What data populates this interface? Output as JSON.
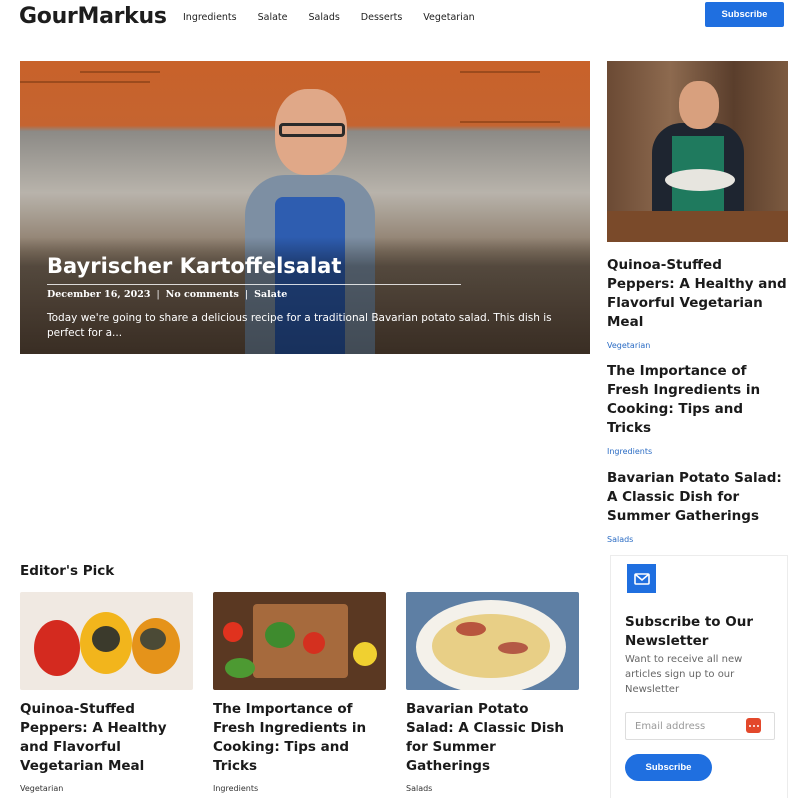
{
  "site": {
    "logo": "GourMarkus"
  },
  "nav": {
    "items": [
      "Ingredients",
      "Salate",
      "Salads",
      "Desserts",
      "Vegetarian"
    ]
  },
  "header": {
    "subscribe_label": "Subscribe"
  },
  "hero": {
    "title": "Bayrischer Kartoffelsalat",
    "date": "December 16, 2023",
    "comments": "No comments",
    "category": "Salate",
    "separator": "|",
    "excerpt": "Today we're going to share a delicious recipe for a traditional Bavarian potato salad. This dish is perfect for a..."
  },
  "sidebar": {
    "posts": [
      {
        "title": "Quinoa-Stuffed Peppers: A Healthy and Flavorful Vegetarian Meal",
        "category": "Vegetarian"
      },
      {
        "title": "The Importance of Fresh Ingredients in Cooking: Tips and Tricks",
        "category": "Ingredients"
      },
      {
        "title": "Bavarian Potato Salad: A Classic Dish for Summer Gatherings",
        "category": "Salads"
      }
    ]
  },
  "editors_pick": {
    "heading": "Editor's Pick",
    "cards": [
      {
        "title": "Quinoa-Stuffed Peppers: A Healthy and Flavorful Vegetarian Meal",
        "category": "Vegetarian"
      },
      {
        "title": "The Importance of Fresh Ingredients in Cooking: Tips and Tricks",
        "category": "Ingredients"
      },
      {
        "title": "Bavarian Potato Salad: A Classic Dish for Summer Gatherings",
        "category": "Salads"
      }
    ]
  },
  "newsletter": {
    "title": "Subscribe to Our Newsletter",
    "text": "Want to receive all new articles sign up to our Newsletter",
    "email_placeholder": "Email address",
    "button_label": "Subscribe"
  },
  "colors": {
    "accent": "#1f6fe0",
    "link": "#2b6cc4"
  },
  "icons": [
    "mail-icon",
    "password-manager-icon"
  ]
}
